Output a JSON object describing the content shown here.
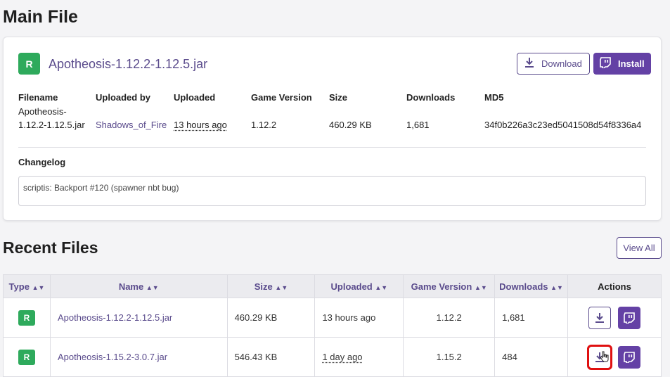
{
  "main_file": {
    "heading": "Main File",
    "badge": "R",
    "name": "Apotheosis-1.12.2-1.12.5.jar",
    "download_label": "Download",
    "install_label": "Install",
    "headers": {
      "filename": "Filename",
      "uploaded_by": "Uploaded by",
      "uploaded": "Uploaded",
      "game_version": "Game Version",
      "size": "Size",
      "downloads": "Downloads",
      "md5": "MD5"
    },
    "values": {
      "filename_line1": "Apotheosis-",
      "filename_line2": "1.12.2-1.12.5.jar",
      "uploaded_by": "Shadows_of_Fire",
      "uploaded": "13 hours ago",
      "game_version": "1.12.2",
      "size": "460.29 KB",
      "downloads": "1,681",
      "md5": "34f0b226a3c23ed5041508d54f8336a4"
    },
    "changelog_heading": "Changelog",
    "changelog_text": "scriptis: Backport #120 (spawner nbt bug)"
  },
  "recent_files": {
    "heading": "Recent Files",
    "view_all_label": "View All",
    "columns": {
      "type": "Type",
      "name": "Name",
      "size": "Size",
      "uploaded": "Uploaded",
      "game_version": "Game Version",
      "downloads": "Downloads",
      "actions": "Actions"
    },
    "rows": [
      {
        "type": "R",
        "name": "Apotheosis-1.12.2-1.12.5.jar",
        "size": "460.29 KB",
        "uploaded": "13 hours ago",
        "game_version": "1.12.2",
        "downloads": "1,681"
      },
      {
        "type": "R",
        "name": "Apotheosis-1.15.2-3.0.7.jar",
        "size": "546.43 KB",
        "uploaded": "1 day ago",
        "game_version": "1.15.2",
        "downloads": "484"
      }
    ]
  },
  "colors": {
    "accent": "#6441a5",
    "link": "#5a4b8c",
    "release_badge": "#2eaa5c",
    "highlight": "#e01010"
  },
  "icons": [
    "download-icon",
    "twitch-icon",
    "sort-icon",
    "cursor-hand-icon"
  ]
}
